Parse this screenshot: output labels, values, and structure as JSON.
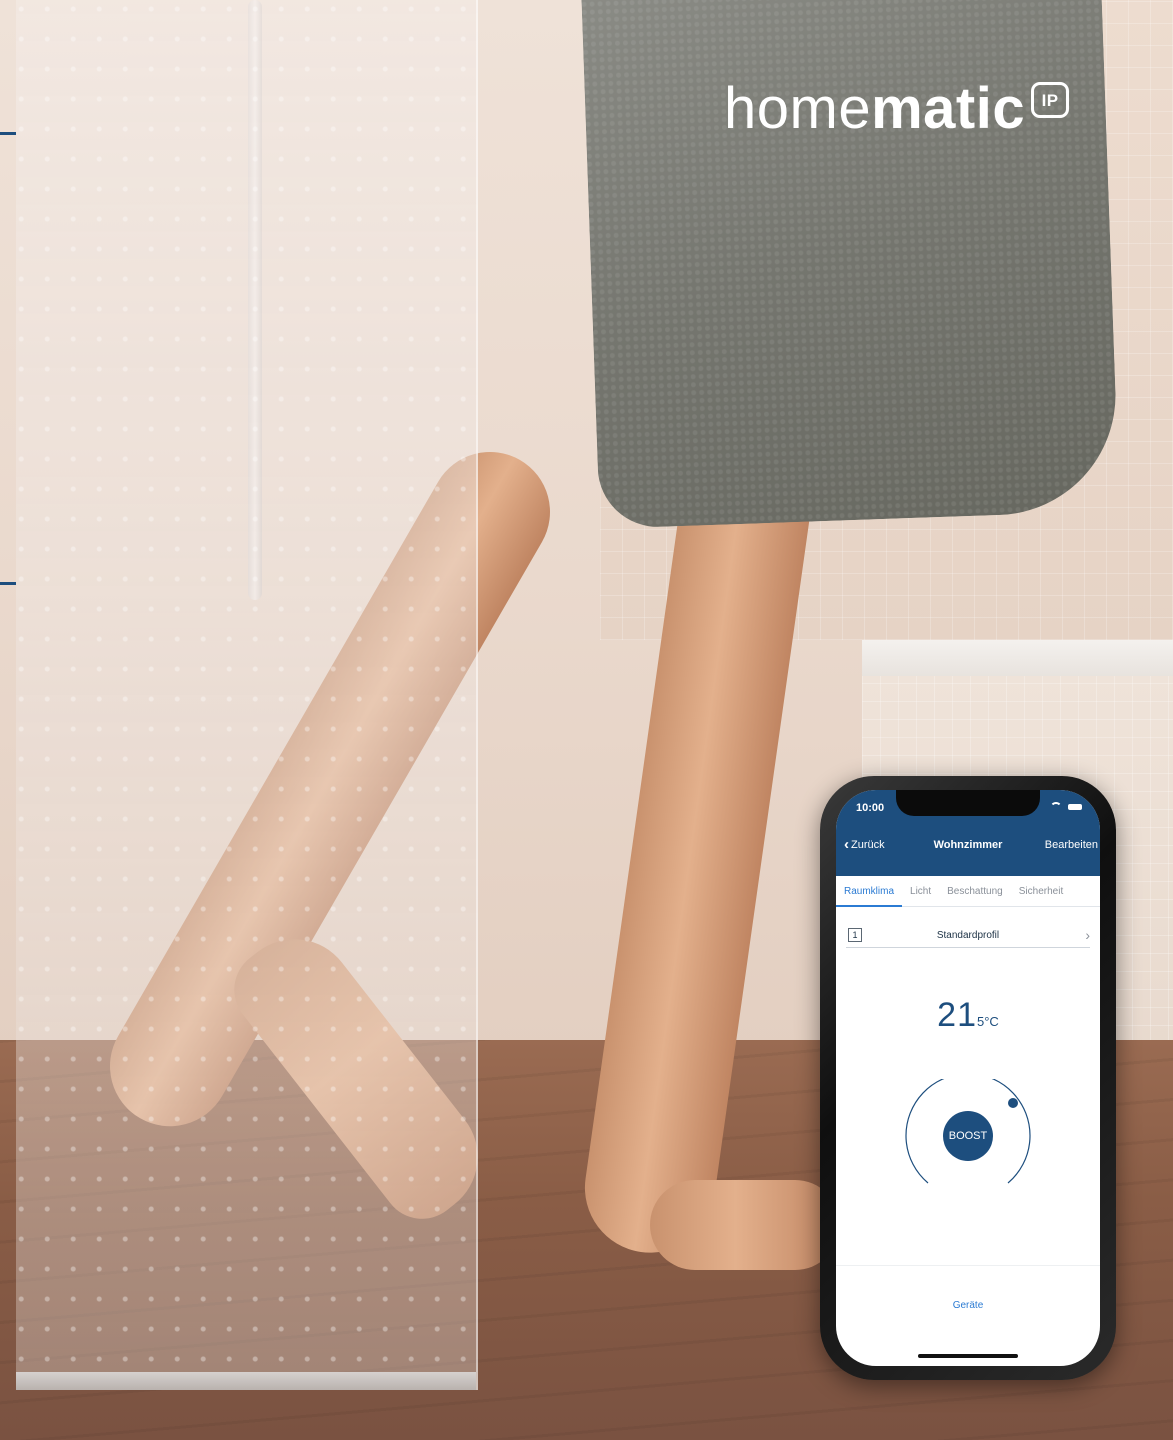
{
  "brand": {
    "logo_light": "home",
    "logo_bold": "matic",
    "badge": "IP"
  },
  "app": {
    "status_time": "10:00",
    "header": {
      "back_label": "Zurück",
      "title": "Wohnzimmer",
      "edit_label": "Bearbeiten"
    },
    "tabs": [
      {
        "label": "Raumklima",
        "active": true
      },
      {
        "label": "Licht",
        "active": false
      },
      {
        "label": "Beschattung",
        "active": false
      },
      {
        "label": "Sicherheit",
        "active": false
      }
    ],
    "profile": {
      "number": "1",
      "name": "Standardprofil"
    },
    "temperature": {
      "main": "21",
      "sub": "5°C"
    },
    "boost_label": "BOOST",
    "devices_label": "Geräte"
  },
  "colors": {
    "primary": "#1d4e7e",
    "accent": "#2b7bd3",
    "logo": "#ffffff"
  }
}
